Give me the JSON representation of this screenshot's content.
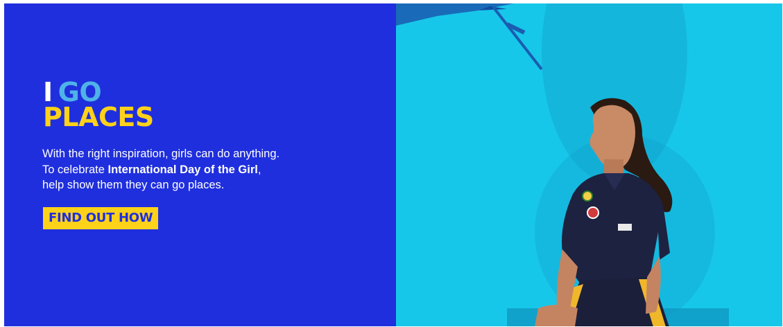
{
  "hero": {
    "headline_word1": "I",
    "headline_word2": "GO",
    "headline_word3": "PLACES",
    "line1": "With the right inspiration, girls can do anything.",
    "line2_prefix": "To celebrate ",
    "line2_bold": "International Day of the Girl",
    "line2_suffix": ",",
    "line3": "help show them they can go places.",
    "cta_label": "FIND OUT HOW"
  },
  "colors": {
    "left_panel": "#1f2fdd",
    "right_panel": "#17c7ea",
    "accent_yellow": "#ffd21a",
    "accent_blue": "#4fb2e8"
  }
}
